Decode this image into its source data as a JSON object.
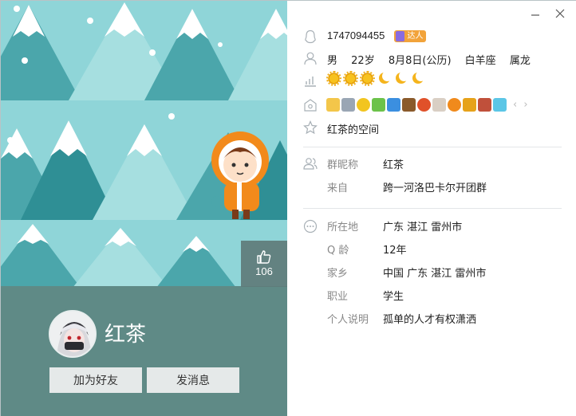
{
  "window": {
    "minimize_icon": "minimize-icon",
    "close_icon": "close-icon"
  },
  "left": {
    "like_count": "106",
    "nickname": "红茶",
    "add_friend_label": "加为好友",
    "send_message_label": "发消息"
  },
  "right": {
    "qq_number": "1747094455",
    "daren_badge": "达人",
    "basic": {
      "gender": "男",
      "age": "22岁",
      "birthday": "8月8日(公历)",
      "constellation": "白羊座",
      "zodiac": "属龙"
    },
    "level": {
      "suns": 3,
      "moons": 3
    },
    "space_link": "红茶的空间",
    "group": {
      "nick_label": "群昵称",
      "nick_value": "红茶",
      "from_label": "来自",
      "from_value": "跨一河洛巴卡尔开团群"
    },
    "details": {
      "location_label": "所在地",
      "location_value": "广东 湛江 雷州市",
      "qage_label": "Q 龄",
      "qage_value": "12年",
      "hometown_label": "家乡",
      "hometown_value": "中国 广东 湛江 雷州市",
      "job_label": "职业",
      "job_value": "学生",
      "bio_label": "个人说明",
      "bio_value": "孤单的人才有权潇洒"
    }
  },
  "colors": {
    "sky": "#8fd5d8",
    "tree_dark": "#4ba6ab",
    "tree_light": "#a6dfe0",
    "snow": "#ffffff",
    "profile_band": "#5f8a86",
    "button_bg": "#e5e9e9"
  }
}
